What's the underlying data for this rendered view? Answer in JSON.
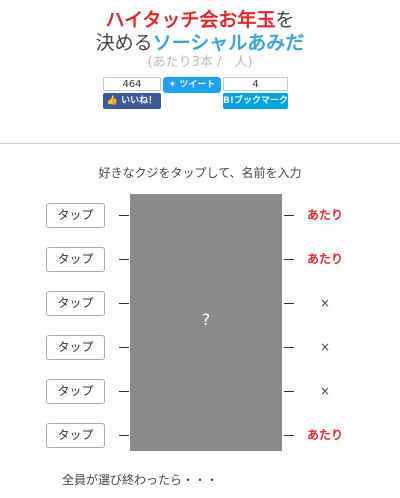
{
  "header": {
    "title_line1": "ハイタッチ会お年玉",
    "title_line1_suffix": "を",
    "title_line2_prefix": "決める",
    "title_line2": "ソーシャルあみだ",
    "subtitle": "(あたり3本 /　人)"
  },
  "social": {
    "facebook_count": "464",
    "facebook_label": "いいね！",
    "tweet_label": "ツイート",
    "hatena_count": "4",
    "hatena_label": "B!ブックマーク"
  },
  "instruction": "好きなクジをタップして、名前を入力",
  "board": {
    "center": "?"
  },
  "rows": [
    {
      "button": "タップ",
      "result": "あたり",
      "hit": true
    },
    {
      "button": "タップ",
      "result": "あたり",
      "hit": true
    },
    {
      "button": "タップ",
      "result": "×",
      "hit": false
    },
    {
      "button": "タップ",
      "result": "×",
      "hit": false
    },
    {
      "button": "タップ",
      "result": "×",
      "hit": false
    },
    {
      "button": "タップ",
      "result": "あたり",
      "hit": true
    }
  ],
  "footer": "全員が選び終わったら・・・",
  "colors": {
    "accent_red": "#e8242c",
    "accent_blue": "#3aa3d9",
    "board": "#8a8a8a"
  }
}
